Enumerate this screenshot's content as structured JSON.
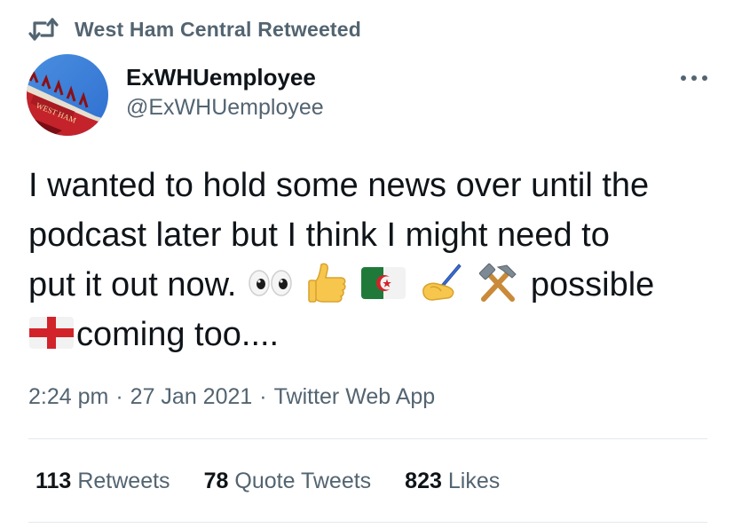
{
  "retweet_context": {
    "icon": "retweet-icon",
    "label": "West Ham Central Retweeted"
  },
  "author": {
    "display_name": "ExWHUemployee",
    "handle": "@ExWHUemployee",
    "avatar": "stadium-avatar"
  },
  "tweet": {
    "line1": "I wanted to hold some news over until the",
    "line2": "podcast later but I think I might need to",
    "line3_start": "put it out now.",
    "line3_end": "possible",
    "line4_end": "coming too....",
    "emojis": [
      "eyes-icon",
      "thumbs-up-icon",
      "algeria-flag-icon",
      "writing-hand-icon",
      "hammer-and-pick-icon",
      "england-flag-icon"
    ]
  },
  "meta": {
    "time": "2:24 pm",
    "separator": "·",
    "date": "27 Jan 2021",
    "source": "Twitter Web App"
  },
  "stats": {
    "retweets_count": "113",
    "retweets_label": "Retweets",
    "quotes_count": "78",
    "quotes_label": "Quote Tweets",
    "likes_count": "823",
    "likes_label": "Likes"
  },
  "colors": {
    "text_primary": "#0f1419",
    "text_secondary": "#536471",
    "divider": "#e1e8ed"
  }
}
